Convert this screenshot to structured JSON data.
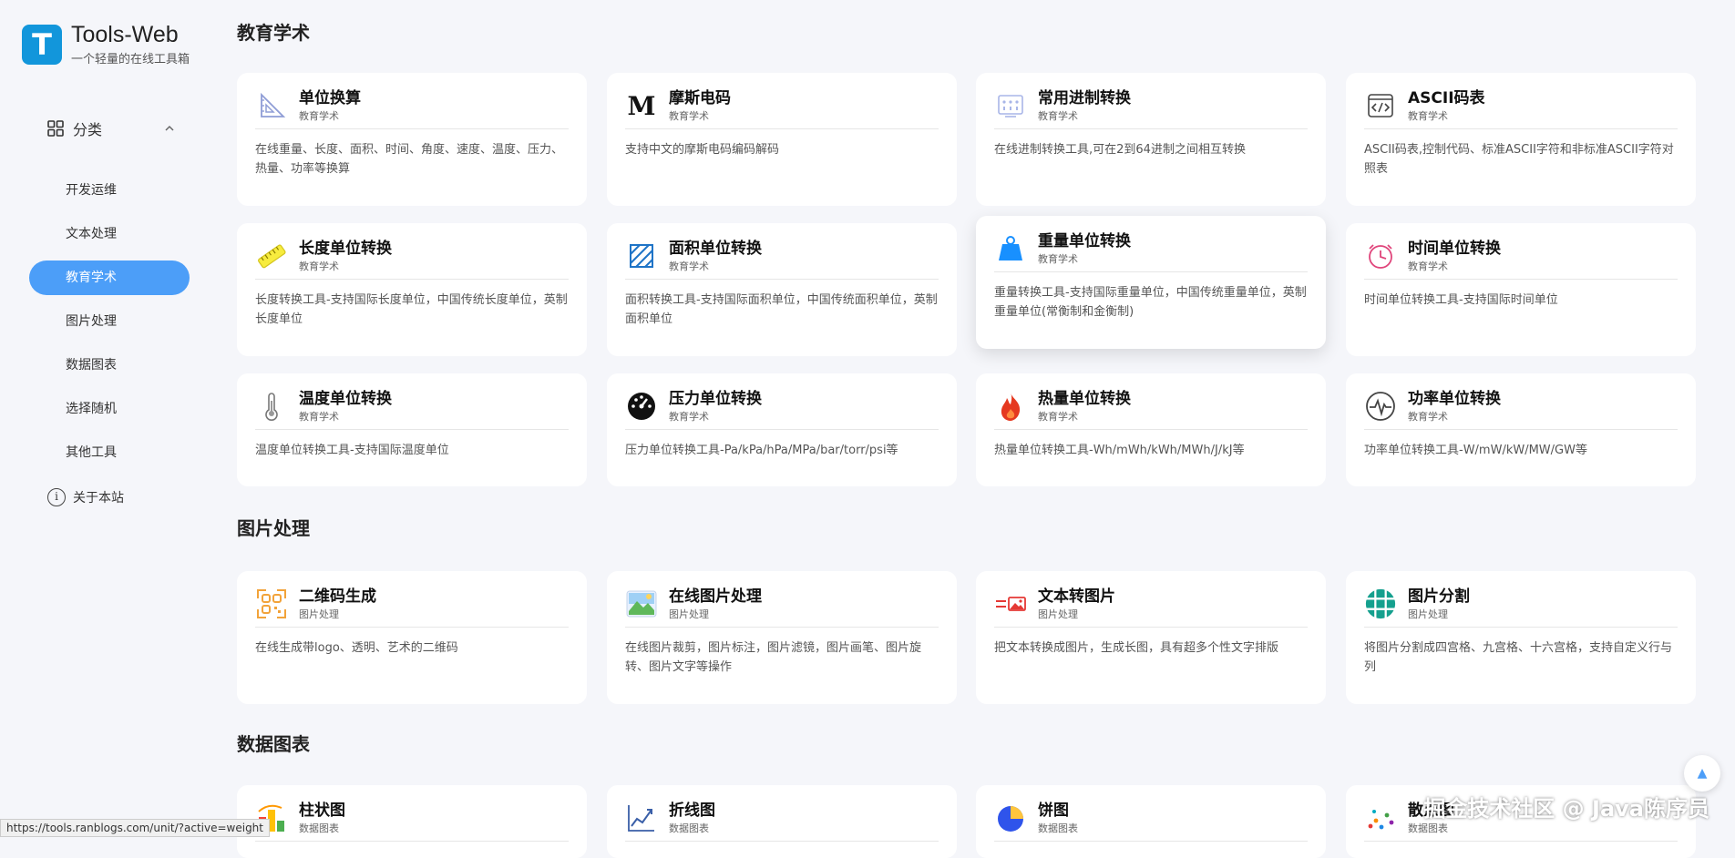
{
  "brand": {
    "title": "Tools-Web",
    "subtitle": "一个轻量的在线工具箱",
    "mark": "T"
  },
  "sidebar": {
    "category_label": "分类",
    "items": [
      {
        "label": "开发运维",
        "active": false
      },
      {
        "label": "文本处理",
        "active": false
      },
      {
        "label": "教育学术",
        "active": true
      },
      {
        "label": "图片处理",
        "active": false
      },
      {
        "label": "数据图表",
        "active": false
      },
      {
        "label": "选择随机",
        "active": false
      },
      {
        "label": "其他工具",
        "active": false
      }
    ],
    "about_label": "关于本站"
  },
  "sections": [
    {
      "title": "教育学术",
      "cards": [
        {
          "title": "单位换算",
          "category": "教育学术",
          "desc": "在线重量、长度、面积、时间、角度、速度、温度、压力、热量、功率等换算",
          "icon": "ruler-triangle-icon"
        },
        {
          "title": "摩斯电码",
          "category": "教育学术",
          "desc": "支持中文的摩斯电码编码解码",
          "icon": "morse-m-icon"
        },
        {
          "title": "常用进制转换",
          "category": "教育学术",
          "desc": "在线进制转换工具,可在2到64进制之间相互转换",
          "icon": "binary-board-icon"
        },
        {
          "title": "ASCII码表",
          "category": "教育学术",
          "desc": "ASCII码表,控制代码、标准ASCII字符和非标准ASCII字符对照表",
          "icon": "code-window-icon"
        },
        {
          "title": "长度单位转换",
          "category": "教育学术",
          "desc": "长度转换工具-支持国际长度单位，中国传统长度单位，英制长度单位",
          "icon": "ruler-icon"
        },
        {
          "title": "面积单位转换",
          "category": "教育学术",
          "desc": "面积转换工具-支持国际面积单位，中国传统面积单位，英制面积单位",
          "icon": "area-hatch-icon"
        },
        {
          "title": "重量单位转换",
          "category": "教育学术",
          "desc": "重量转换工具-支持国际重量单位，中国传统重量单位，英制重量单位(常衡制和金衡制)",
          "icon": "weight-icon"
        },
        {
          "title": "时间单位转换",
          "category": "教育学术",
          "desc": "时间单位转换工具-支持国际时间单位",
          "icon": "clock-icon"
        },
        {
          "title": "温度单位转换",
          "category": "教育学术",
          "desc": "温度单位转换工具-支持国际温度单位",
          "icon": "thermometer-icon"
        },
        {
          "title": "压力单位转换",
          "category": "教育学术",
          "desc": "压力单位转换工具-Pa/kPa/hPa/MPa/bar/torr/psi等",
          "icon": "gauge-icon"
        },
        {
          "title": "热量单位转换",
          "category": "教育学术",
          "desc": "热量单位转换工具-Wh/mWh/kWh/MWh/J/kJ等",
          "icon": "flame-icon"
        },
        {
          "title": "功率单位转换",
          "category": "教育学术",
          "desc": "功率单位转换工具-W/mW/kW/MW/GW等",
          "icon": "pulse-icon"
        }
      ]
    },
    {
      "title": "图片处理",
      "cards": [
        {
          "title": "二维码生成",
          "category": "图片处理",
          "desc": "在线生成带logo、透明、艺术的二维码",
          "icon": "qrcode-icon"
        },
        {
          "title": "在线图片处理",
          "category": "图片处理",
          "desc": "在线图片裁剪，图片标注，图片滤镜，图片画笔、图片旋转、图片文字等操作",
          "icon": "landscape-image-icon"
        },
        {
          "title": "文本转图片",
          "category": "图片处理",
          "desc": "把文本转换成图片，生成长图，具有超多个性文字排版",
          "icon": "text-to-image-icon"
        },
        {
          "title": "图片分割",
          "category": "图片处理",
          "desc": "将图片分割成四宫格、九宫格、十六宫格，支持自定义行与列",
          "icon": "grid-split-icon"
        }
      ]
    },
    {
      "title": "数据图表",
      "cards": [
        {
          "title": "柱状图",
          "category": "数据图表",
          "desc": "",
          "icon": "bar-chart-icon"
        },
        {
          "title": "折线图",
          "category": "数据图表",
          "desc": "",
          "icon": "line-chart-icon"
        },
        {
          "title": "饼图",
          "category": "数据图表",
          "desc": "",
          "icon": "pie-chart-icon"
        },
        {
          "title": "散点图",
          "category": "数据图表",
          "desc": "",
          "icon": "scatter-chart-icon"
        }
      ]
    }
  ],
  "status_url": "https://tools.ranblogs.com/unit/?active=weight",
  "watermark": "掘金技术社区 @ Java陈序员",
  "colors": {
    "accent": "#4c9ef8",
    "brand": "#1296db"
  }
}
